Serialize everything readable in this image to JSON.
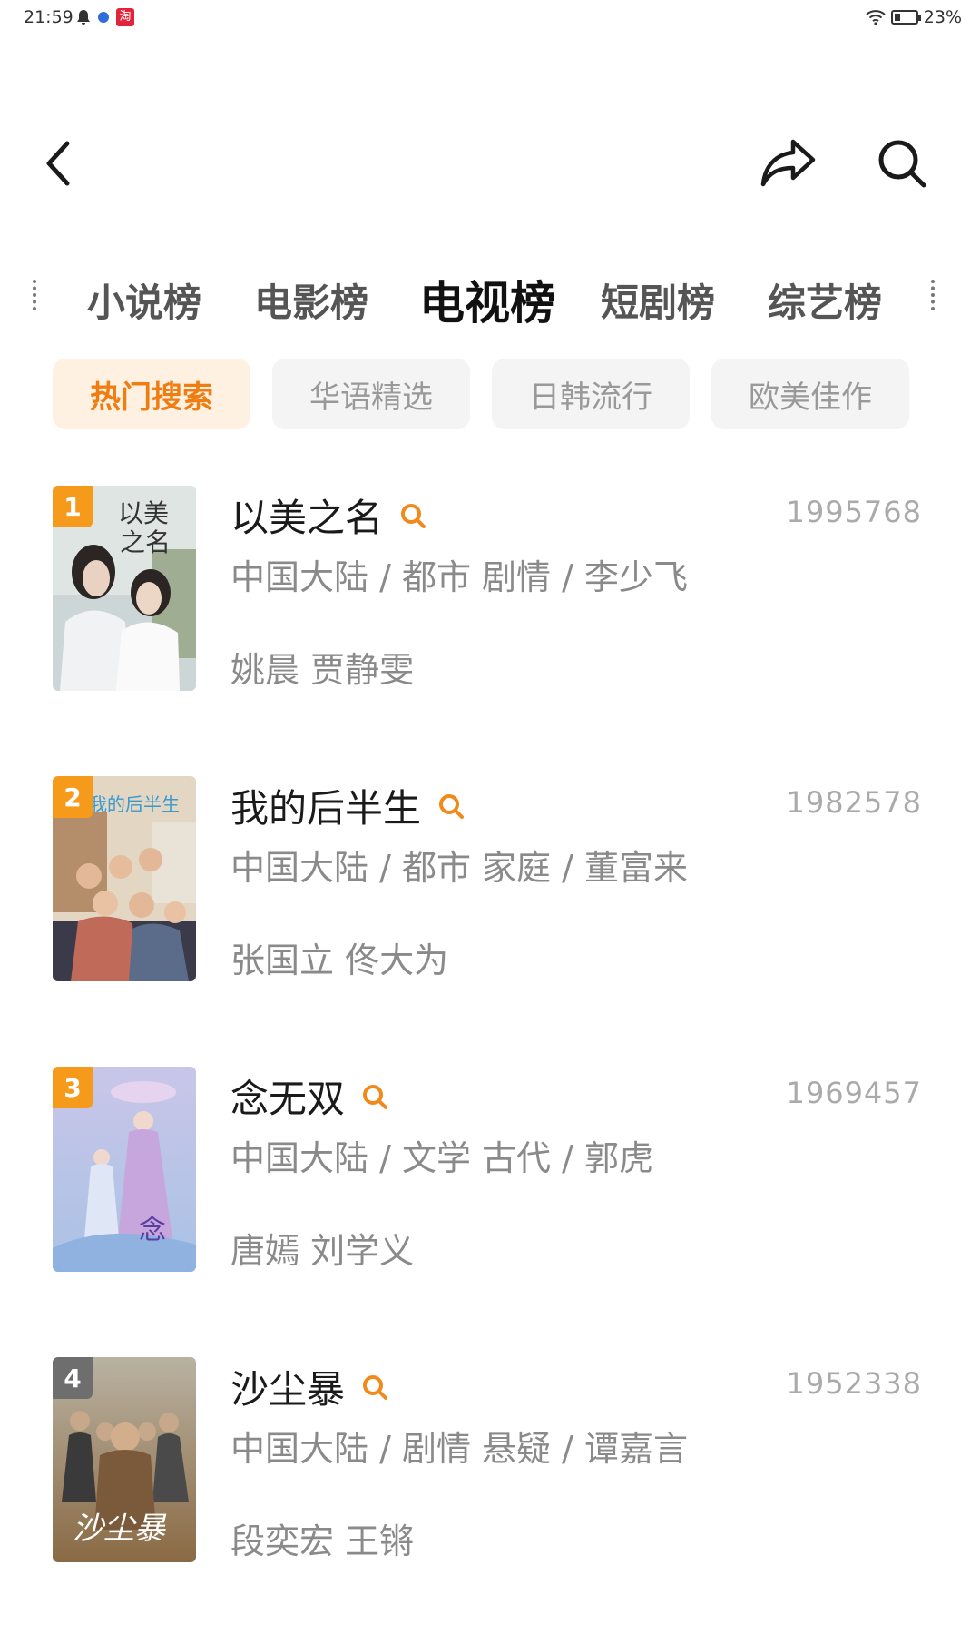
{
  "status_bar": {
    "time": "21:59",
    "taobao_label": "淘",
    "battery": "23%"
  },
  "header": {
    "back_icon": "chevron-left-icon",
    "share_icon": "share-icon",
    "search_icon": "search-icon"
  },
  "category_tabs": [
    {
      "label": "小说榜",
      "active": false
    },
    {
      "label": "电影榜",
      "active": false
    },
    {
      "label": "电视榜",
      "active": true
    },
    {
      "label": "短剧榜",
      "active": false
    },
    {
      "label": "综艺榜",
      "active": false
    }
  ],
  "filter_chips": [
    {
      "label": "热门搜索",
      "active": true
    },
    {
      "label": "华语精选",
      "active": false
    },
    {
      "label": "日韩流行",
      "active": false
    },
    {
      "label": "欧美佳作",
      "active": false
    }
  ],
  "ranking": [
    {
      "rank": "1",
      "title": "以美之名",
      "count": "1995768",
      "meta": "中国大陆 / 都市 剧情 / 李少飞",
      "actors": "姚晨 贾静雯",
      "rank_color": "#f59a1b"
    },
    {
      "rank": "2",
      "title": "我的后半生",
      "count": "1982578",
      "meta": "中国大陆 / 都市 家庭 / 董富来",
      "actors": "张国立 佟大为",
      "rank_color": "#f59a1b"
    },
    {
      "rank": "3",
      "title": "念无双",
      "count": "1969457",
      "meta": "中国大陆 / 文学 古代 / 郭虎",
      "actors": "唐嫣 刘学义",
      "rank_color": "#f59a1b"
    },
    {
      "rank": "4",
      "title": "沙尘暴",
      "count": "1952338",
      "meta": "中国大陆 / 剧情 悬疑 / 谭嘉言",
      "actors": "段奕宏 王锵",
      "rank_color": "#6e6e6e"
    }
  ],
  "colors": {
    "accent": "#f07d12",
    "chip_active_bg": "#fff1e2"
  }
}
